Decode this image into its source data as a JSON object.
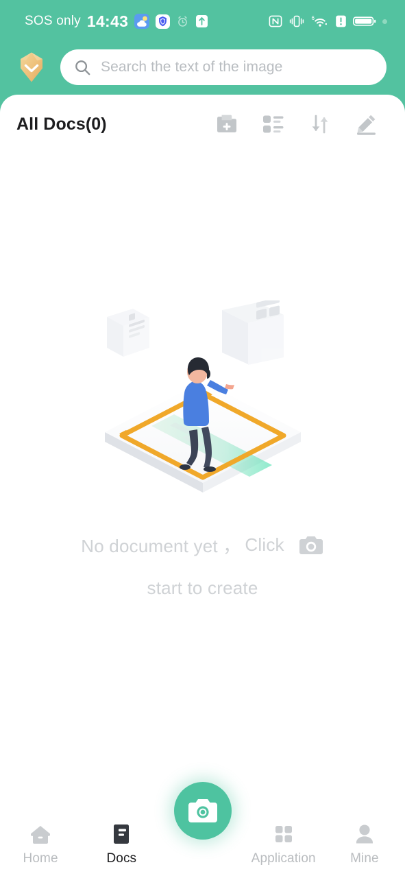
{
  "statusbar": {
    "carrier": "SOS only",
    "time": "14:43",
    "left_icons": [
      "weather-icon",
      "security-shield-icon",
      "alarm-icon",
      "upload-arrow-icon"
    ],
    "right_icons": [
      "nfc-icon",
      "vibrate-icon",
      "wifi-6-icon",
      "sim-alert-icon",
      "battery-icon",
      "status-dot"
    ],
    "wifi_label": "6"
  },
  "header": {
    "logo_name": "app-logo-diamond",
    "accent_green": "#53c2a0",
    "logo_gold": "#e9bf78"
  },
  "search": {
    "placeholder": "Search the text of the image",
    "icon": "search-icon"
  },
  "docbar": {
    "title": "All Docs(0)",
    "tools": [
      {
        "name": "new-folder-icon",
        "label": "New folder"
      },
      {
        "name": "list-view-icon",
        "label": "List view"
      },
      {
        "name": "sort-icon",
        "label": "Sort"
      },
      {
        "name": "edit-icon",
        "label": "Edit"
      }
    ]
  },
  "empty_state": {
    "line1_before": "No document yet ，",
    "line1_click": "Click",
    "line1_icon": "camera-icon",
    "line2": "start to create",
    "illustration": "person-scanning-documents-isometric",
    "text_color": "#cfd2d5"
  },
  "bottomnav": {
    "items": [
      {
        "label": "Home",
        "icon": "home-icon",
        "active": false
      },
      {
        "label": "Docs",
        "icon": "docs-icon",
        "active": true
      },
      {
        "label": "Application",
        "icon": "grid-apps-icon",
        "active": false
      },
      {
        "label": "Mine",
        "icon": "person-icon",
        "active": false
      }
    ],
    "fab": {
      "name": "camera-capture-button",
      "icon": "camera-icon",
      "color": "#4ec3a0"
    }
  }
}
